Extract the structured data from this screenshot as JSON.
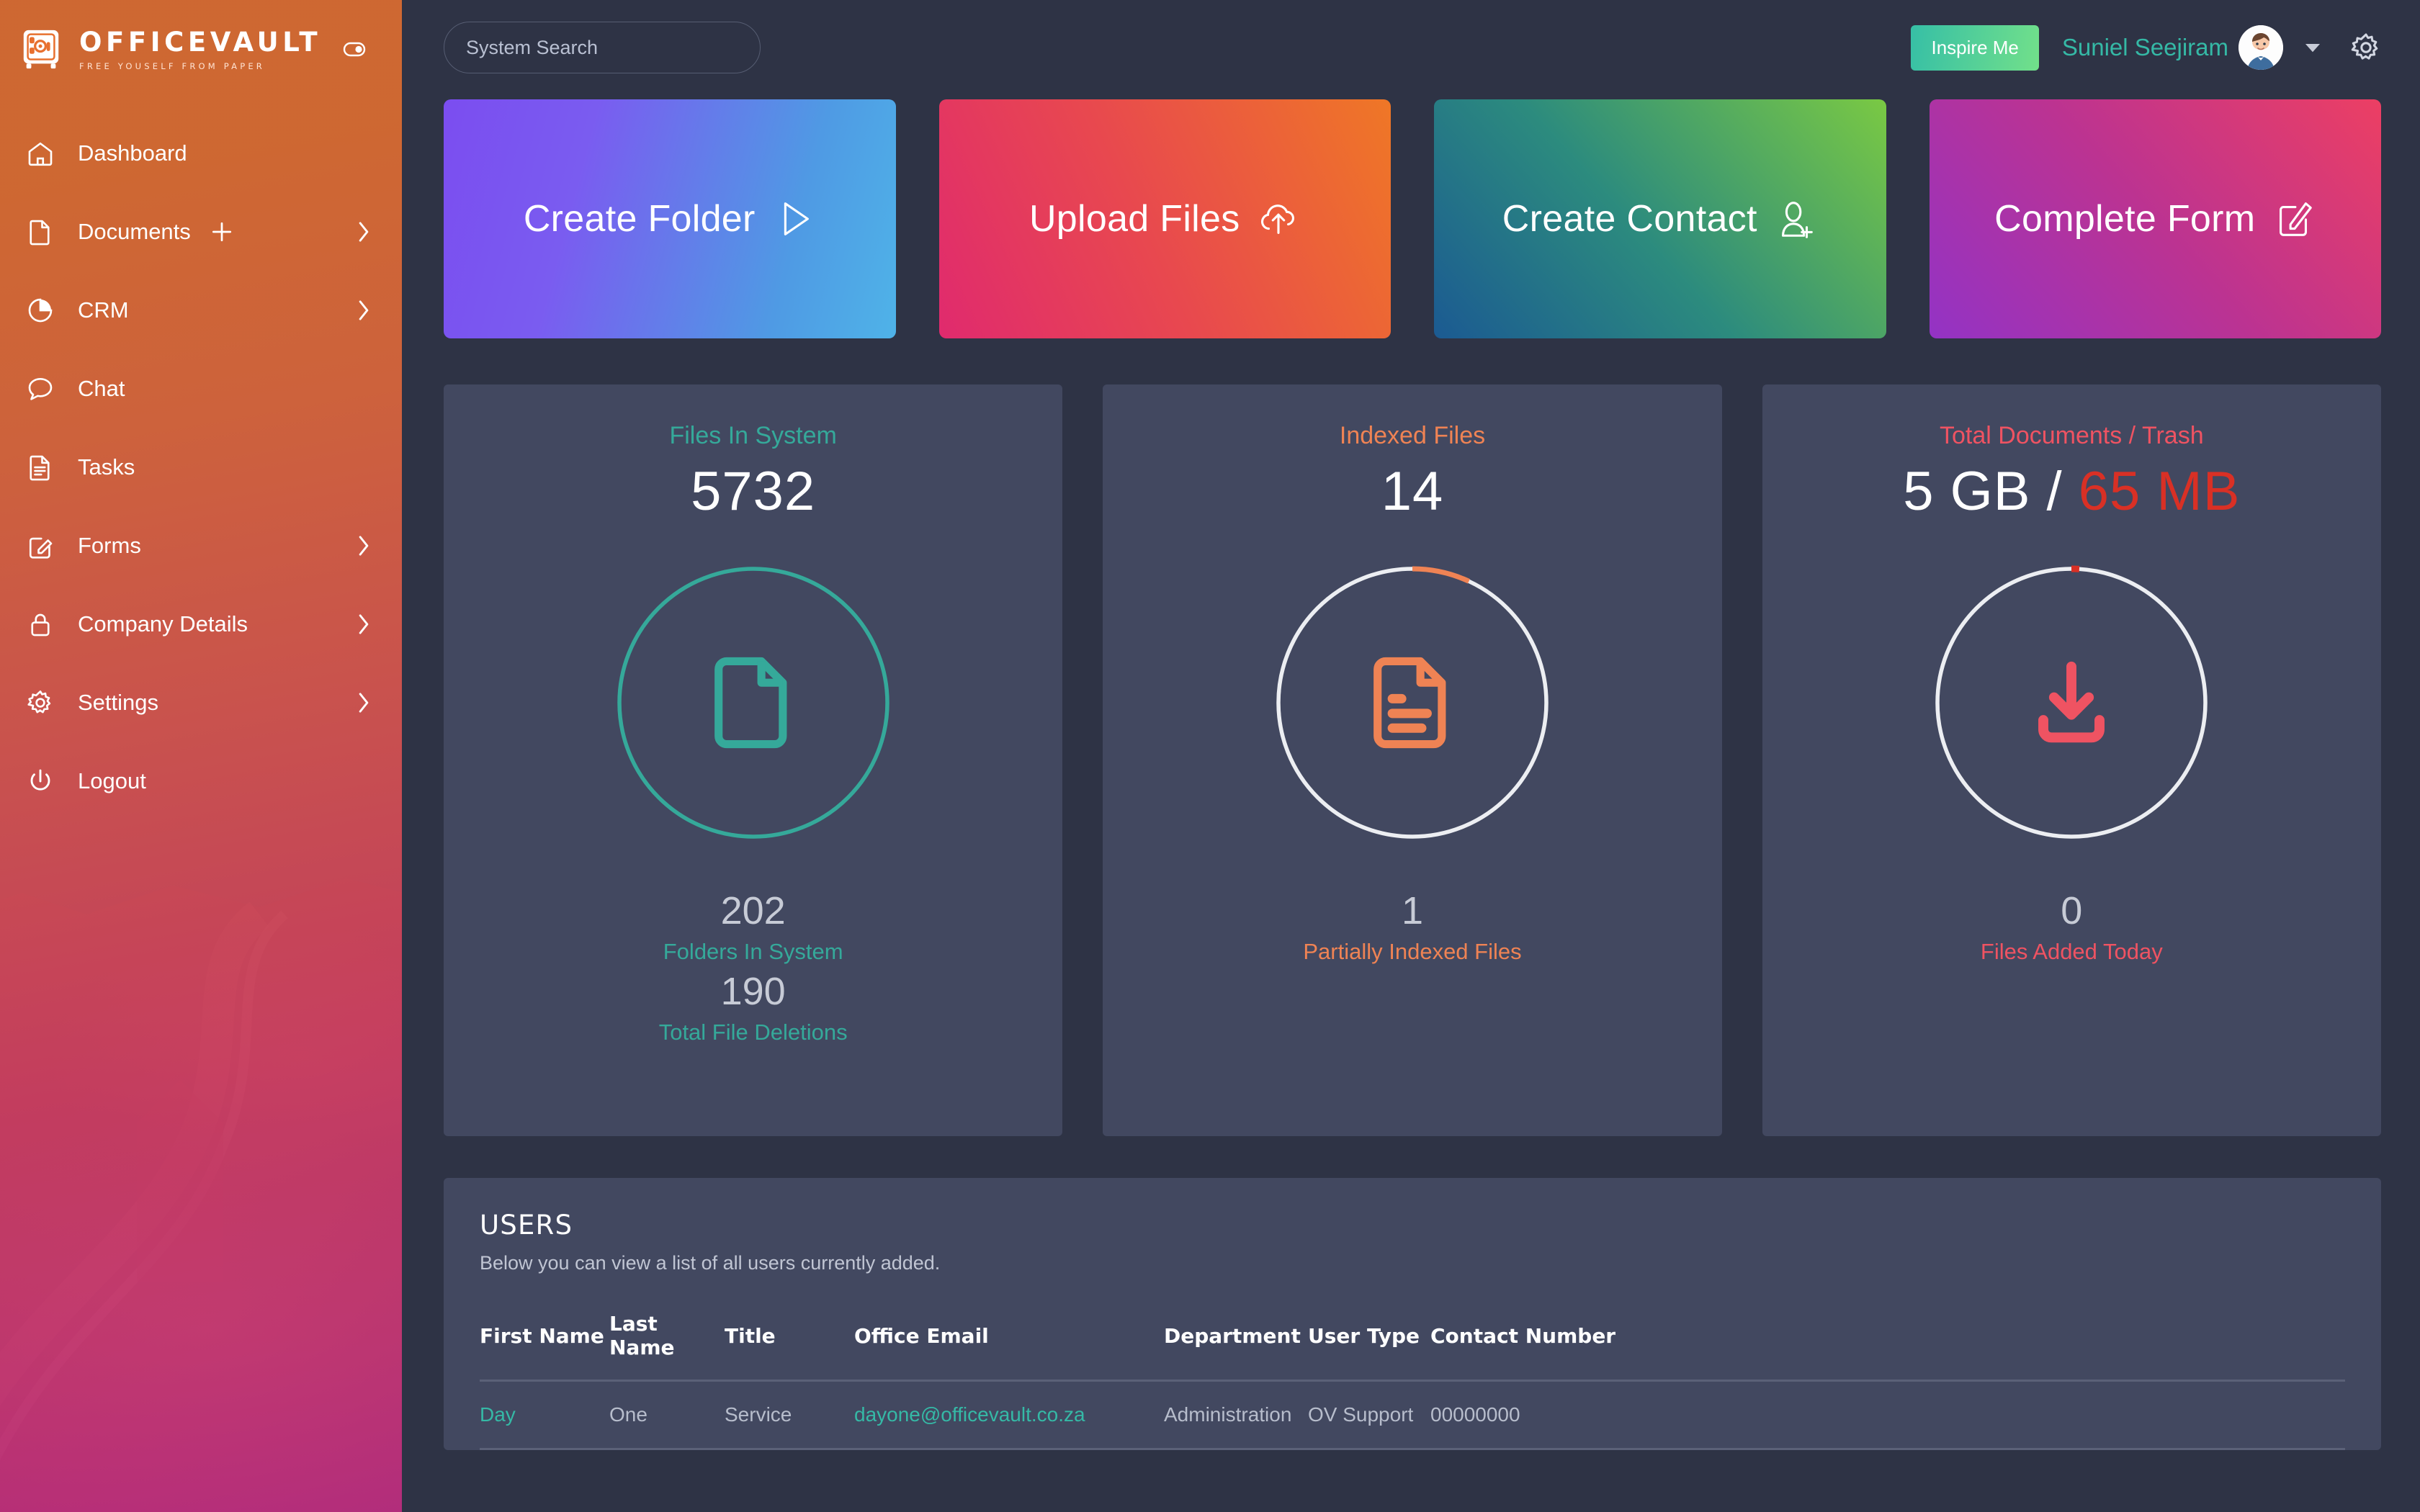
{
  "brand": {
    "name": "OFFICEVAULT",
    "tagline": "FREE YOUSELF FROM PAPER",
    "logo_icon": "vault-safe-icon",
    "toggle_icon": "sidebar-toggle-icon",
    "colors": {
      "gradient_start": "#e8702f",
      "gradient_end": "#c42d85"
    }
  },
  "sidebar": {
    "items": [
      {
        "label": "Dashboard",
        "icon": "home-icon",
        "chevron": false,
        "plus": false
      },
      {
        "label": "Documents",
        "icon": "document-icon",
        "chevron": true,
        "plus": true
      },
      {
        "label": "CRM",
        "icon": "pie-chart-icon",
        "chevron": true,
        "plus": false
      },
      {
        "label": "Chat",
        "icon": "chat-bubble-icon",
        "chevron": false,
        "plus": false
      },
      {
        "label": "Tasks",
        "icon": "task-list-icon",
        "chevron": false,
        "plus": false
      },
      {
        "label": "Forms",
        "icon": "edit-square-icon",
        "chevron": true,
        "plus": false
      },
      {
        "label": "Company Details",
        "icon": "lock-icon",
        "chevron": true,
        "plus": false
      },
      {
        "label": "Settings",
        "icon": "gear-icon",
        "chevron": true,
        "plus": false
      },
      {
        "label": "Logout",
        "icon": "power-icon",
        "chevron": false,
        "plus": false
      }
    ]
  },
  "topbar": {
    "search_placeholder": "System Search",
    "search_value": "",
    "inspire_label": "Inspire Me",
    "user_name": "Suniel Seejiram",
    "avatar_icon": "user-avatar",
    "caret_icon": "chevron-down-icon",
    "gear_icon": "gear-icon",
    "accent": "#35b9a6"
  },
  "actions": [
    {
      "label": "Create Folder",
      "icon": "play-triangle-icon"
    },
    {
      "label": "Upload Files",
      "icon": "cloud-upload-icon"
    },
    {
      "label": "Create Contact",
      "icon": "user-plus-icon"
    },
    {
      "label": "Complete Form",
      "icon": "edit-square-icon"
    }
  ],
  "stats": [
    {
      "title": "Files In System",
      "value": "5732",
      "ring_color": "#35a99a",
      "ring_percent": 100,
      "icon": "document-outline-icon",
      "sub_value": "202",
      "sub_label": "Folders In System",
      "sub_value2": "190",
      "sub_label2": "Total File Deletions"
    },
    {
      "title": "Indexed Files",
      "value": "14",
      "ring_color": "#ef8354",
      "ring_track": "#eceef2",
      "ring_percent": 7,
      "icon": "indexed-document-icon",
      "sub_value": "1",
      "sub_label": "Partially Indexed Files"
    },
    {
      "title": "Total Documents / Trash",
      "value_primary": "5 GB",
      "value_separator": " / ",
      "value_secondary": "65 MB",
      "ring_color": "#d93025",
      "ring_track": "#eceef2",
      "ring_percent": 1,
      "icon": "download-icon",
      "sub_value": "0",
      "sub_label": "Files Added Today"
    }
  ],
  "users": {
    "heading": "USERS",
    "subtitle": "Below you can view a list of all users currently added.",
    "columns": [
      "First Name",
      "Last Name",
      "Title",
      "Office Email",
      "Department",
      "User Type",
      "Contact Number"
    ],
    "rows": [
      {
        "first_name": "Day",
        "last_name": "One",
        "title": "Service",
        "email": "dayone@officevault.co.za",
        "department": "Administration",
        "user_type": "OV Support",
        "contact": "00000000"
      }
    ]
  }
}
